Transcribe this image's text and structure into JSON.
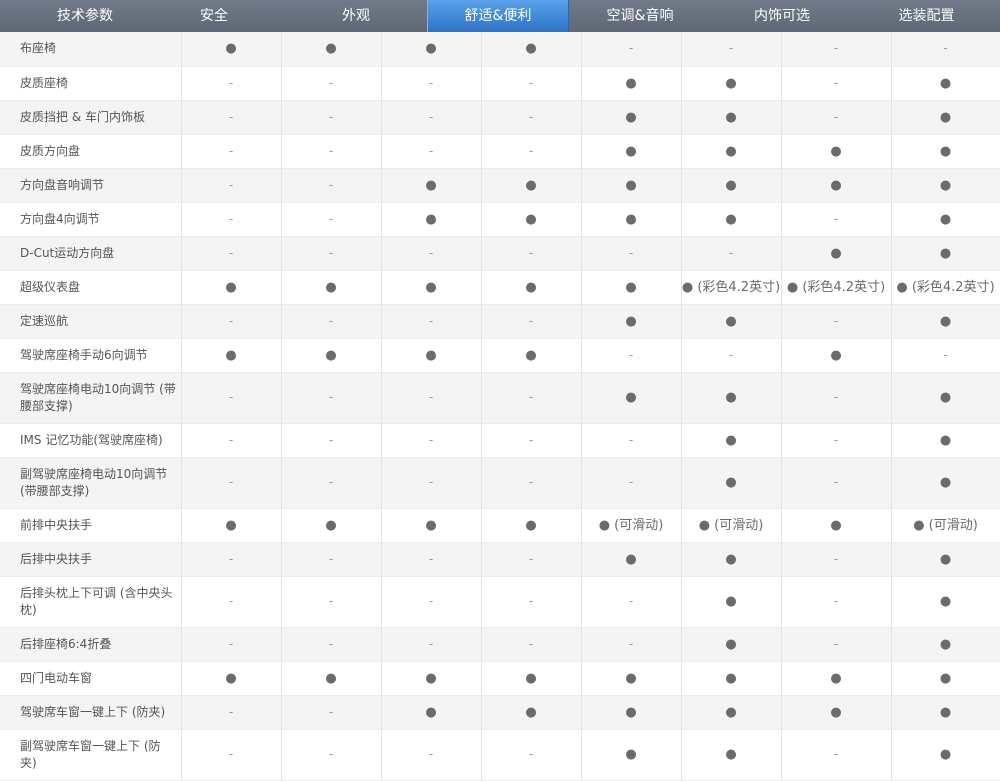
{
  "tabs": [
    {
      "label": "技术参数",
      "active": false
    },
    {
      "label": "安全",
      "active": false
    },
    {
      "label": "外观",
      "active": false
    },
    {
      "label": "舒适&便利",
      "active": true
    },
    {
      "label": "空调&音响",
      "active": false
    },
    {
      "label": "内饰可选",
      "active": false
    },
    {
      "label": "选装配置",
      "active": false
    }
  ],
  "rows": [
    {
      "label": "布座椅",
      "cells": [
        "●",
        "●",
        "●",
        "●",
        "-",
        "-",
        "-",
        "-"
      ]
    },
    {
      "label": "皮质座椅",
      "cells": [
        "-",
        "-",
        "-",
        "-",
        "●",
        "●",
        "-",
        "●"
      ]
    },
    {
      "label": "皮质挡把 & 车门内饰板",
      "cells": [
        "-",
        "-",
        "-",
        "-",
        "●",
        "●",
        "-",
        "●"
      ]
    },
    {
      "label": "皮质方向盘",
      "cells": [
        "-",
        "-",
        "-",
        "-",
        "●",
        "●",
        "●",
        "●"
      ]
    },
    {
      "label": "方向盘音响调节",
      "cells": [
        "-",
        "-",
        "●",
        "●",
        "●",
        "●",
        "●",
        "●"
      ]
    },
    {
      "label": "方向盘4向调节",
      "cells": [
        "-",
        "-",
        "●",
        "●",
        "●",
        "●",
        "-",
        "●"
      ]
    },
    {
      "label": "D-Cut运动方向盘",
      "cells": [
        "-",
        "-",
        "-",
        "-",
        "-",
        "-",
        "●",
        "●"
      ]
    },
    {
      "label": "超级仪表盘",
      "cells": [
        "●",
        "●",
        "●",
        "●",
        "●",
        "● (彩色4.2英寸)",
        "● (彩色4.2英寸)",
        "● (彩色4.2英寸)"
      ]
    },
    {
      "label": "定速巡航",
      "cells": [
        "-",
        "-",
        "-",
        "-",
        "●",
        "●",
        "-",
        "●"
      ]
    },
    {
      "label": "驾驶席座椅手动6向调节",
      "cells": [
        "●",
        "●",
        "●",
        "●",
        "-",
        "-",
        "●",
        "-"
      ]
    },
    {
      "label": "驾驶席座椅电动10向调节 (带腰部支撑)",
      "cells": [
        "-",
        "-",
        "-",
        "-",
        "●",
        "●",
        "-",
        "●"
      ]
    },
    {
      "label": "IMS 记忆功能(驾驶席座椅)",
      "cells": [
        "-",
        "-",
        "-",
        "-",
        "-",
        "●",
        "-",
        "●"
      ]
    },
    {
      "label": "副驾驶席座椅电动10向调节 (带腰部支撑)",
      "cells": [
        "-",
        "-",
        "-",
        "-",
        "-",
        "●",
        "-",
        "●"
      ]
    },
    {
      "label": "前排中央扶手",
      "cells": [
        "●",
        "●",
        "●",
        "●",
        "● (可滑动)",
        "● (可滑动)",
        "●",
        "● (可滑动)"
      ]
    },
    {
      "label": "后排中央扶手",
      "cells": [
        "-",
        "-",
        "-",
        "-",
        "●",
        "●",
        "-",
        "●"
      ]
    },
    {
      "label": "后排头枕上下可调 (含中央头枕)",
      "cells": [
        "-",
        "-",
        "-",
        "-",
        "-",
        "●",
        "-",
        "●"
      ]
    },
    {
      "label": "后排座椅6:4折叠",
      "cells": [
        "-",
        "-",
        "-",
        "-",
        "-",
        "●",
        "-",
        "●"
      ]
    },
    {
      "label": "四门电动车窗",
      "cells": [
        "●",
        "●",
        "●",
        "●",
        "●",
        "●",
        "●",
        "●"
      ]
    },
    {
      "label": "驾驶席车窗一键上下 (防夹)",
      "cells": [
        "-",
        "-",
        "●",
        "●",
        "●",
        "●",
        "●",
        "●"
      ]
    },
    {
      "label": "副驾驶席车窗一键上下 (防夹)",
      "cells": [
        "-",
        "-",
        "-",
        "-",
        "●",
        "●",
        "-",
        "●"
      ]
    }
  ]
}
